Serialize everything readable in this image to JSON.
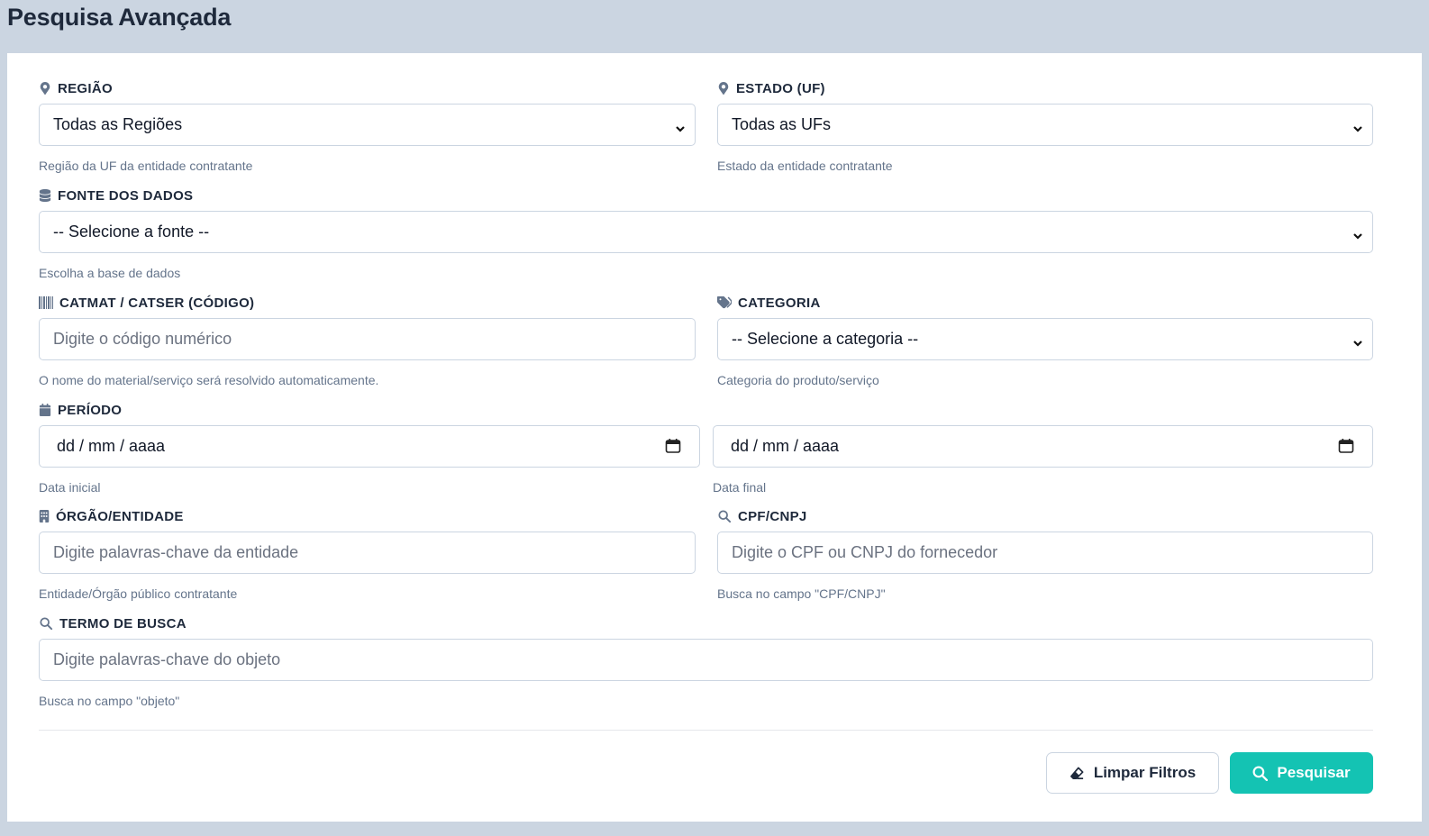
{
  "page": {
    "title": "Pesquisa Avançada"
  },
  "fields": {
    "regiao": {
      "label": "REGIÃO",
      "value": "Todas as Regiões",
      "help": "Região da UF da entidade contratante",
      "icon": "map-marker-icon"
    },
    "estado": {
      "label": "ESTADO (UF)",
      "value": "Todas as UFs",
      "help": "Estado da entidade contratante",
      "icon": "map-marker-icon"
    },
    "fonte": {
      "label": "FONTE DOS DADOS",
      "value": "-- Selecione a fonte --",
      "help": "Escolha a base de dados",
      "icon": "database-icon"
    },
    "catmat": {
      "label": "CATMAT / CATSER (CÓDIGO)",
      "placeholder": "Digite o código numérico",
      "help": "O nome do material/serviço será resolvido automaticamente.",
      "icon": "barcode-icon"
    },
    "categoria": {
      "label": "CATEGORIA",
      "value": "-- Selecione a categoria --",
      "help": "Categoria do produto/serviço",
      "icon": "tags-icon"
    },
    "periodo": {
      "label": "PERÍODO",
      "icon": "calendar-icon",
      "start": {
        "value": "dd / mm / aaaa",
        "help": "Data inicial"
      },
      "end": {
        "value": "dd / mm / aaaa",
        "help": "Data final"
      }
    },
    "orgao": {
      "label": "ÓRGÃO/ENTIDADE",
      "placeholder": "Digite palavras-chave da entidade",
      "help": "Entidade/Órgão público contratante",
      "icon": "building-icon"
    },
    "cpf": {
      "label": "CPF/CNPJ",
      "placeholder": "Digite o CPF ou CNPJ do fornecedor",
      "help": "Busca no campo \"CPF/CNPJ\"",
      "icon": "search-icon"
    },
    "termo": {
      "label": "TERMO DE BUSCA",
      "placeholder": "Digite palavras-chave do objeto",
      "help": "Busca no campo \"objeto\"",
      "icon": "search-icon"
    }
  },
  "actions": {
    "clear_label": "Limpar Filtros",
    "search_label": "Pesquisar"
  },
  "colors": {
    "accent": "#14c3b3",
    "background": "#cbd5e1",
    "label_icon": "#64748b"
  }
}
